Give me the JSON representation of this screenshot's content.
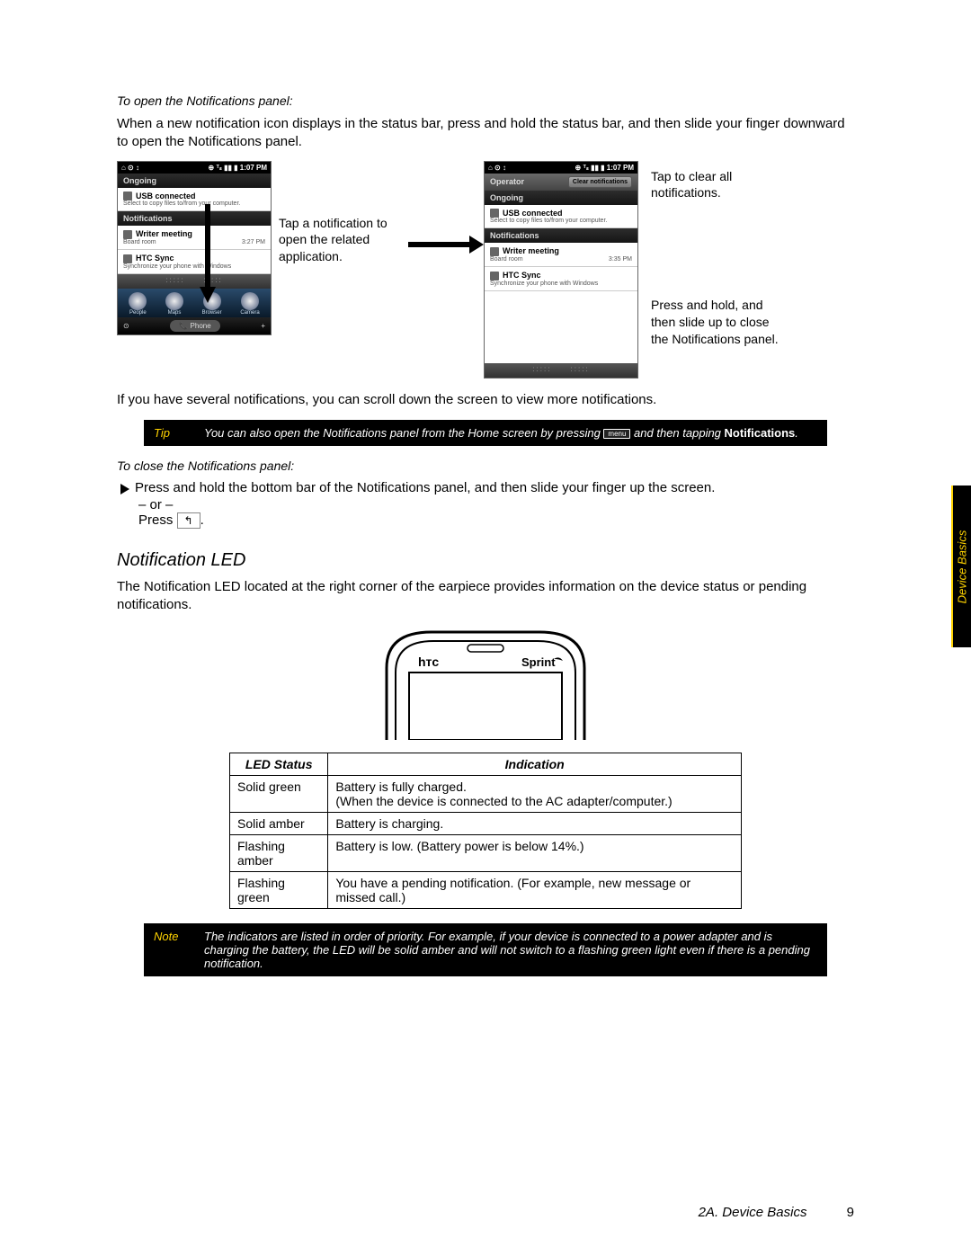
{
  "heading_open": "To open the Notifications panel:",
  "intro_open": "When a new notification icon displays in the status bar, press and hold the status bar, and then slide your finger downward to open the Notifications panel.",
  "phone_left": {
    "status_left": "⌂ ⊙ ↕",
    "status_right": "⊕ ᵀₛ ▮▮ ▮ 1:07 PM",
    "ongoing_label": "Ongoing",
    "usb_title": "USB connected",
    "usb_sub": "Select to copy files to/from your computer.",
    "notif_label": "Notifications",
    "writer_title": "Writer meeting",
    "writer_sub": "Board room",
    "writer_time": "3:27 PM",
    "sync_title": "HTC Sync",
    "sync_sub": "Synchronize your phone with Windows",
    "dock": [
      "People",
      "Maps",
      "Browser",
      "Camera"
    ],
    "bottom_left": "⊙",
    "bottom_mid": "📞 Phone",
    "bottom_right": "+"
  },
  "caption_left": "Tap a notification to open the related application.",
  "phone_right": {
    "status_left": "⌂ ⊙ ↕",
    "status_right": "⊕ ᵀₛ ▮▮ ▮ 1:07 PM",
    "operator": "Operator",
    "clear": "Clear notifications",
    "ongoing_label": "Ongoing",
    "usb_title": "USB connected",
    "usb_sub": "Select to copy files to/from your computer.",
    "notif_label": "Notifications",
    "writer_title": "Writer meeting",
    "writer_sub": "Board room",
    "writer_time": "3:35 PM",
    "sync_title": "HTC Sync",
    "sync_sub": "Synchronize your phone with Windows"
  },
  "caption_clear": "Tap to clear all notifications.",
  "caption_close": "Press and hold, and then slide up to close the Notifications panel.",
  "scroll_note": "If you have several notifications, you can scroll down the screen to view more notifications.",
  "tip": {
    "tag": "Tip",
    "text_a": "You can also open the Notifications panel from the Home screen by pressing ",
    "menu_key": "menu",
    "text_b": " and then tapping ",
    "bold": "Notifications",
    "tail": "."
  },
  "heading_close": "To close the Notifications panel:",
  "close_bullet": "Press and hold the bottom bar of the Notifications panel, and then slide your finger up the screen.",
  "or": "– or –",
  "press_label": "Press ",
  "back_key": "↰",
  "period": ".",
  "led_section_title": "Notification LED",
  "led_intro": "The Notification LED located at the right corner of the earpiece provides information on the device status or pending notifications.",
  "outline": {
    "brand_left": "hтc",
    "brand_right": "Sprint"
  },
  "table": {
    "h1": "LED Status",
    "h2": "Indication",
    "rows": [
      {
        "s": "Solid green",
        "i": "Battery is fully charged.\n(When the device is connected to the AC adapter/computer.)"
      },
      {
        "s": "Solid amber",
        "i": "Battery is charging."
      },
      {
        "s": "Flashing amber",
        "i": "Battery is low. (Battery power is below 14%.)"
      },
      {
        "s": "Flashing green",
        "i": "You have a pending notification. (For example, new message or missed call.)"
      }
    ]
  },
  "note": {
    "tag": "Note",
    "text": "The indicators are listed in order of priority. For example, if your device is connected to a power adapter and is charging the battery, the LED will be solid amber and will not switch to a flashing green light even if there is a pending notification."
  },
  "footer_section": "2A. Device Basics",
  "footer_page": "9",
  "sidetab": "Device Basics"
}
